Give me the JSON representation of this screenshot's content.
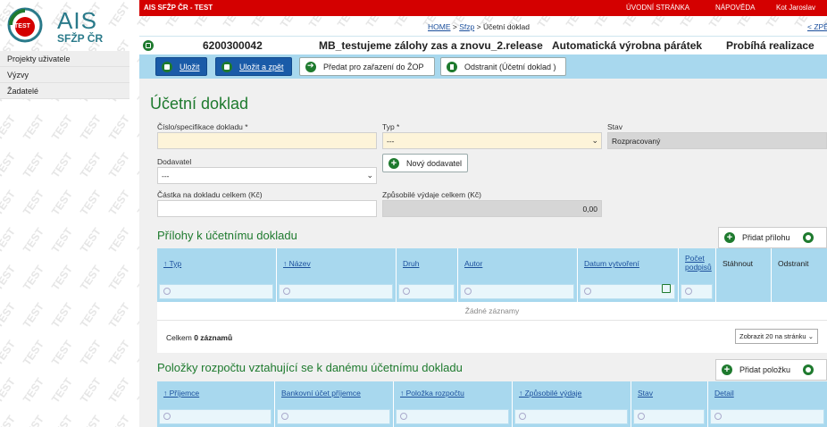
{
  "watermark": "TEST",
  "logo": {
    "badge": "TEST",
    "name": "AIS",
    "sub": "SFŽP ČR"
  },
  "sidebar": {
    "items": [
      {
        "label": "Projekty uživatele"
      },
      {
        "label": "Výzvy"
      },
      {
        "label": "Žadatelé"
      }
    ]
  },
  "topbar": {
    "app": "AIS SFŽP ČR - TEST",
    "home": "ÚVODNÍ STRÁNKA",
    "help": "NÁPOVĚDA",
    "user": "Kot Jaroslav"
  },
  "breadcrumb": {
    "home": "HOME",
    "sep1": ">",
    "sfzp": "Sfzp",
    "sep2": ">",
    "current": "Účetní doklad",
    "prev": "< ZPĚT"
  },
  "record": {
    "id": "6200300042",
    "name": "MB_testujeme zálohy zas a znovu_2.release",
    "type": "Automatická výrobna párátek",
    "status": "Probíhá realizace"
  },
  "toolbar": {
    "save": "Uložit",
    "save_back": "Uložit a zpět",
    "submit": "Předat pro zařazení do ŽOP",
    "delete": "Odstranit (Účetní doklad )"
  },
  "form": {
    "title": "Účetní doklad",
    "doc_number_label": "Číslo/specifikace dokladu *",
    "doc_number_value": "",
    "type_label": "Typ *",
    "type_value": "---",
    "state_label": "Stav",
    "state_value": "Rozpracovaný",
    "supplier_label": "Dodavatel",
    "supplier_value": "---",
    "new_supplier": "Nový dodavatel",
    "amount_label": "Částka na dokladu celkem (Kč)",
    "amount_value": "",
    "eligible_label": "Způsobilé výdaje celkem (Kč)",
    "eligible_value": "0,00"
  },
  "attachments": {
    "title": "Přílohy k účetnímu dokladu",
    "add": "Přidat přílohu",
    "columns": [
      "↑ Typ",
      "↑ Název",
      "Druh",
      "Autor",
      "Datum vytvoření",
      "Počet podpisů",
      "Stáhnout",
      "Odstranit"
    ],
    "empty": "Žádné záznamy",
    "total_prefix": "Celkem",
    "total_value": "0 záznamů",
    "pager": "Zobrazit 20 na stránku"
  },
  "budget": {
    "title": "Položky rozpočtu vztahující se k danému účetnímu dokladu",
    "add": "Přidat položku",
    "columns": [
      "↑ Příjemce",
      "Bankovní účet příjemce",
      "↑ Položka rozpočtu",
      "↑ Způsobilé výdaje",
      "Stav",
      "Detail"
    ]
  }
}
